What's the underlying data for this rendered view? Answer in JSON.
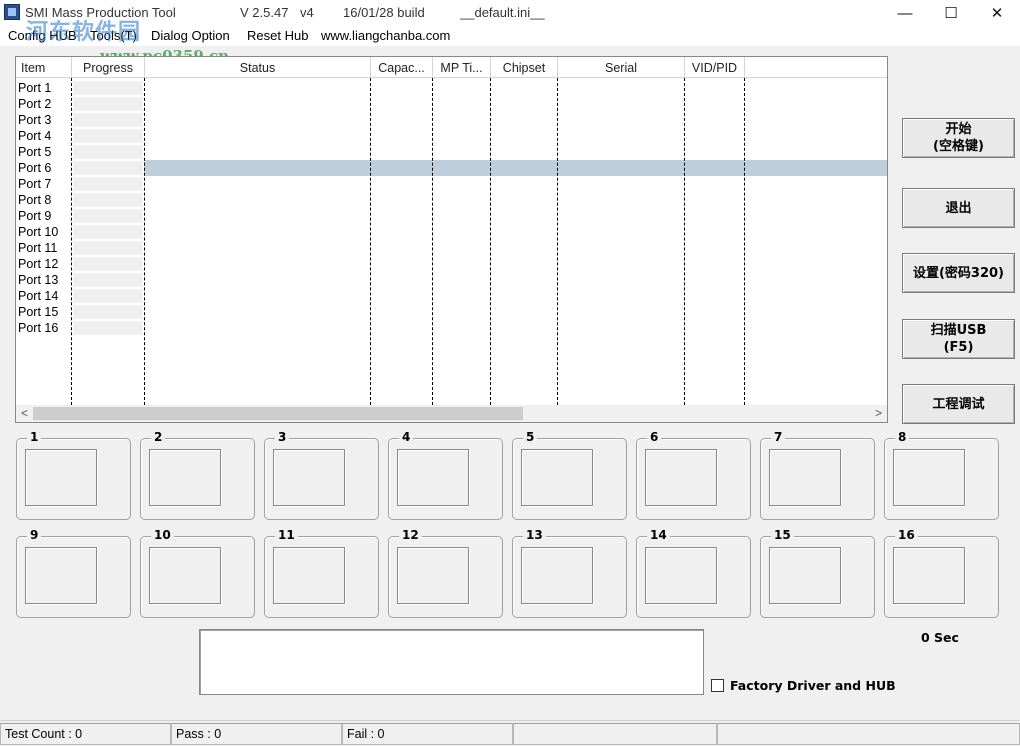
{
  "titlebar": {
    "title": "SMI Mass Production Tool",
    "version": "V 2.5.47",
    "variant": "v4",
    "build": "16/01/28 build",
    "config_file": "__default.ini__",
    "minimize_glyph": "—",
    "maximize_glyph": "☐",
    "close_glyph": "✕",
    "watermark": "河东软件园",
    "watermark_url": "www.pc0359.cn"
  },
  "menu": {
    "items": [
      "Config HUB",
      "Tools(T)",
      "Dialog Option",
      "Reset Hub",
      "www.liangchanba.com"
    ]
  },
  "list": {
    "columns": [
      "Item",
      "Progress",
      "Status",
      "Capac...",
      "MP Ti...",
      "Chipset",
      "Serial",
      "VID/PID"
    ],
    "rows": [
      "Port 1",
      "Port 2",
      "Port 3",
      "Port 4",
      "Port 5",
      "Port 6",
      "Port 7",
      "Port 8",
      "Port 9",
      "Port 10",
      "Port 11",
      "Port 12",
      "Port 13",
      "Port 14",
      "Port 15",
      "Port 16"
    ],
    "selected_row": "Port 6",
    "scroll_left_glyph": "<",
    "scroll_right_glyph": ">"
  },
  "buttons": {
    "start_line1": "开始",
    "start_line2": "(空格键)",
    "exit": "退出",
    "settings": "设置(密码320)",
    "scan_line1": "扫描USB",
    "scan_line2": "(F5)",
    "debug": "工程调试"
  },
  "panels": [
    "1",
    "2",
    "3",
    "4",
    "5",
    "6",
    "7",
    "8",
    "9",
    "10",
    "11",
    "12",
    "13",
    "14",
    "15",
    "16"
  ],
  "bottom": {
    "timer": "0 Sec",
    "factory_label": "Factory Driver and HUB",
    "factory_checked": false
  },
  "status": {
    "test_count": "Test Count : 0",
    "pass": "Pass : 0",
    "fail": "Fail : 0"
  }
}
